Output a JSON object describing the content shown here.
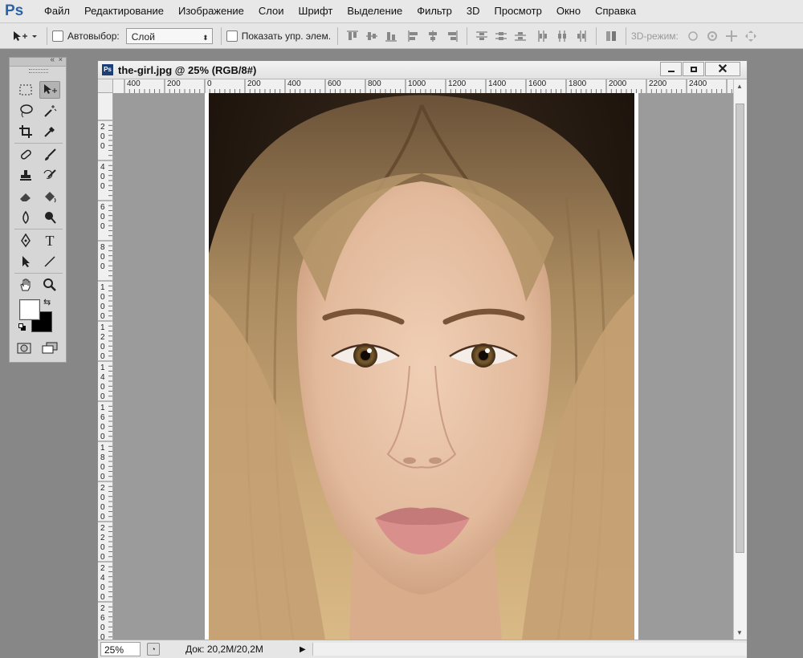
{
  "app": {
    "logo_text": "Ps"
  },
  "menu": [
    "Файл",
    "Редактирование",
    "Изображение",
    "Слои",
    "Шрифт",
    "Выделение",
    "Фильтр",
    "3D",
    "Просмотр",
    "Окно",
    "Справка"
  ],
  "options": {
    "autoselect_label": "Автовыбор:",
    "layer_select_value": "Слой",
    "show_controls_label": "Показать упр. элем.",
    "mode_3d_label": "3D-режим:"
  },
  "document": {
    "title": "the-girl.jpg @ 25% (RGB/8#)",
    "icon_text": "Ps",
    "zoom": "25%",
    "doc_info": "Док: 20,2M/20,2M",
    "ruler_h_labels": [
      "400",
      "200",
      "0",
      "200",
      "400",
      "600",
      "800",
      "1000",
      "1200",
      "1400",
      "1600",
      "1800",
      "2000",
      "2200",
      "2400"
    ],
    "ruler_v_labels": [
      "2 0 0",
      "4 0 0",
      "6 0 0",
      "8 0 0",
      "1 0 0 0",
      "1 2 0 0",
      "1 4 0 0",
      "1 6 0 0",
      "1 8 0 0",
      "2 0 0 0",
      "2 2 0 0",
      "2 4 0 0",
      "2 6 0 0"
    ]
  },
  "colors": {
    "foreground": "#ffffff",
    "background": "#000000",
    "accent": "#2b63a8"
  }
}
